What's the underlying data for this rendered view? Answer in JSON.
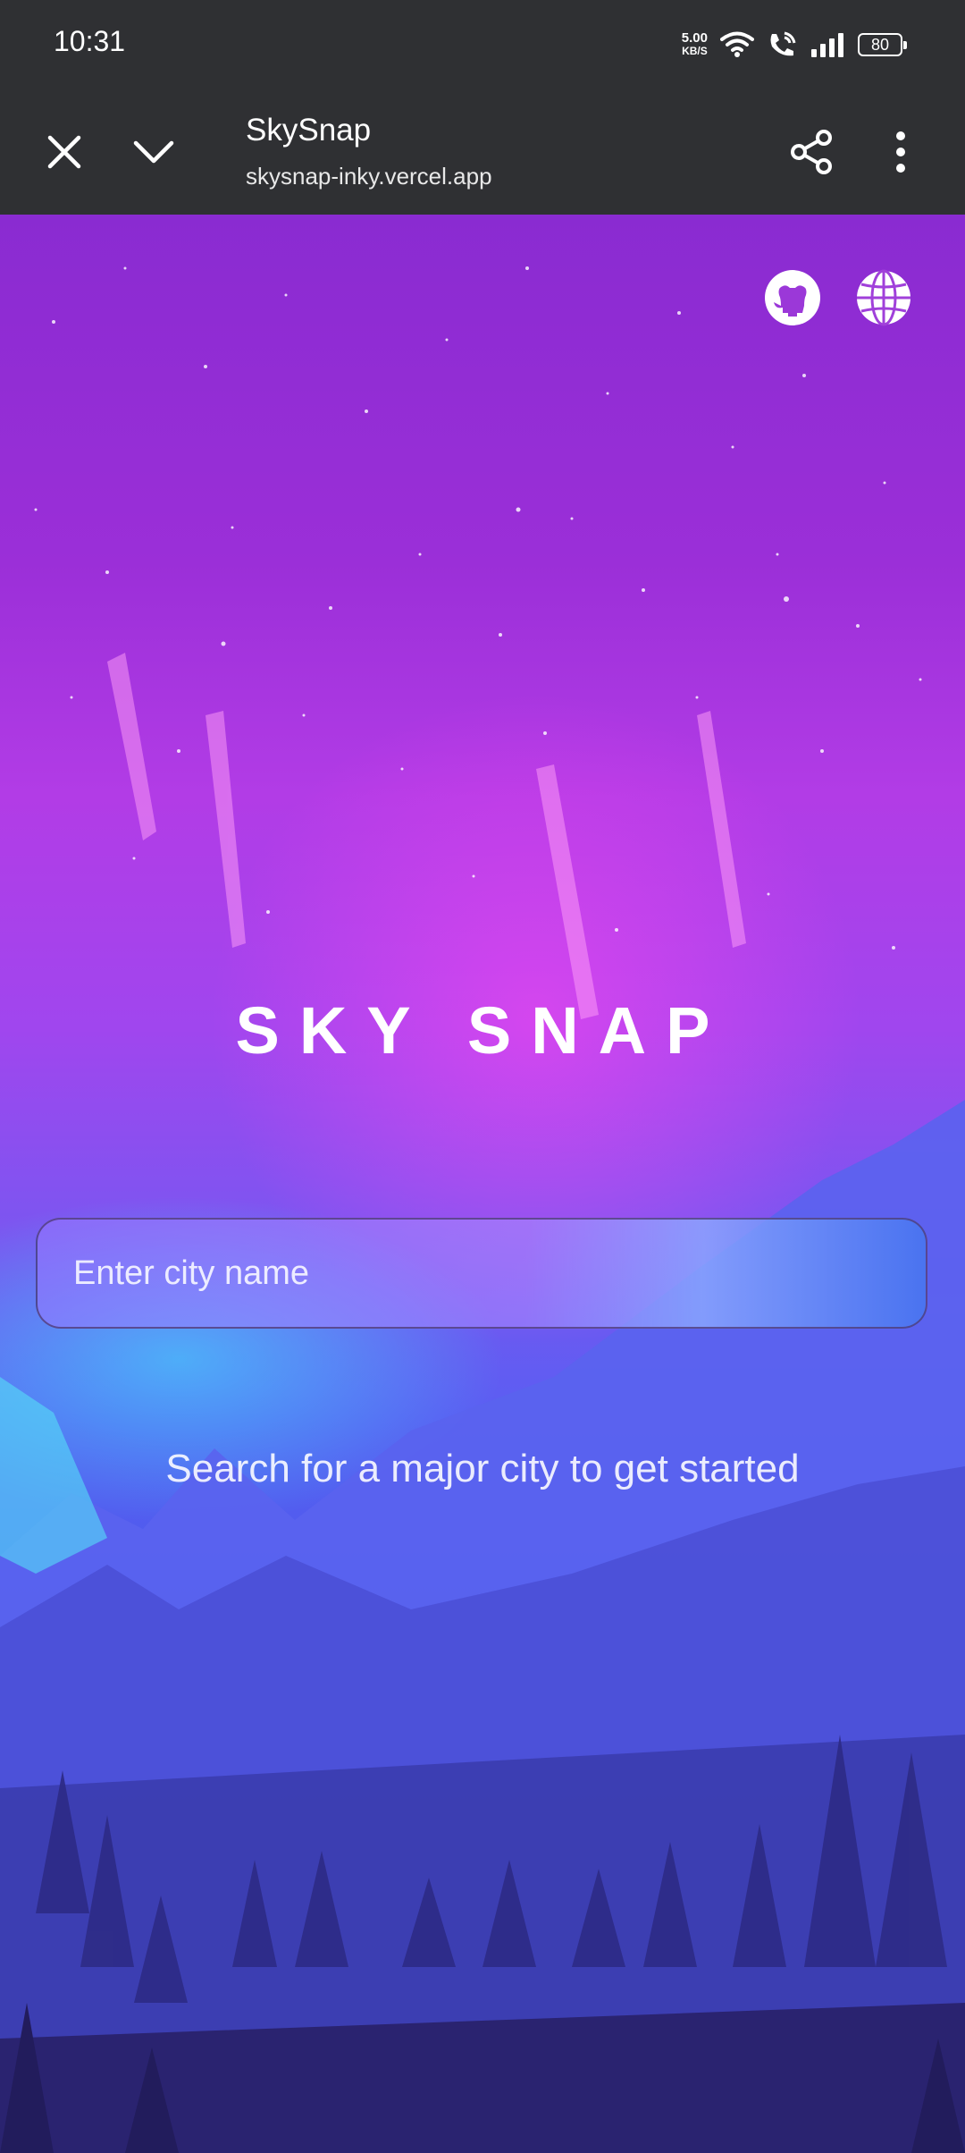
{
  "status_bar": {
    "time": "10:31",
    "net_speed": "5.00",
    "net_unit": "KB/S",
    "battery": "80"
  },
  "browser": {
    "title": "SkySnap",
    "url": "skysnap-inky.vercel.app"
  },
  "page": {
    "app_title": "SKY SNAP",
    "search_placeholder": "Enter city name",
    "hint": "Search for a major city to get started"
  },
  "icons": {
    "close": "close-icon",
    "collapse": "chevron-down-icon",
    "share": "share-icon",
    "menu": "more-vertical-icon",
    "github": "github-icon",
    "website": "globe-icon"
  }
}
